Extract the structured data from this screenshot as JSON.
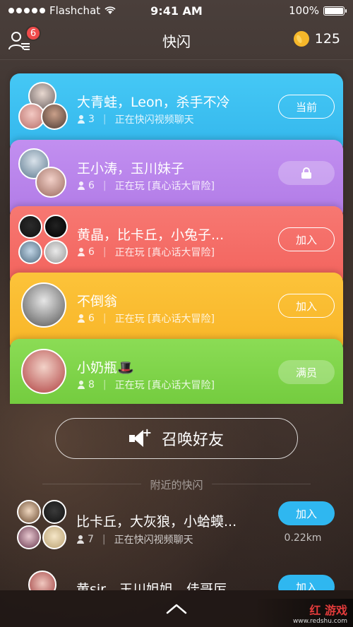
{
  "status": {
    "carrier": "Flashchat",
    "time": "9:41 AM",
    "battery": "100%",
    "battery_level": 1.0
  },
  "header": {
    "title": "快闪",
    "badge_count": "6",
    "coins": "125"
  },
  "rooms": [
    {
      "title": "大青蛙，Leon，杀手不冷",
      "count": "3",
      "activity": "正在快闪视频聊天",
      "button": "当前",
      "color": "#3fc0f2"
    },
    {
      "title": "王小涛，玉川妹子",
      "count": "6",
      "activity": "正在玩 [真心话大冒险]",
      "button": "",
      "button_icon": "lock-icon",
      "color": "#b985ec"
    },
    {
      "title": "黄晶，比卡丘，小兔子...",
      "count": "6",
      "activity": "正在玩 [真心话大冒险]",
      "button": "加入",
      "color": "#f46d67"
    },
    {
      "title": "不倒翁",
      "count": "6",
      "activity": "正在玩 [真心话大冒险]",
      "button": "加入",
      "color": "#fabd32"
    },
    {
      "title": "小奶瓶🎩",
      "count": "8",
      "activity": "正在玩 [真心话大冒险]",
      "button": "满员",
      "color": "#80d44a"
    }
  ],
  "summon": {
    "label": "召唤好友"
  },
  "nearby": {
    "label": "附近的快闪",
    "items": [
      {
        "title": "比卡丘，大灰狼，小蛤蟆...",
        "count": "7",
        "activity": "正在快闪视频聊天",
        "button": "加入",
        "distance": "0.22km"
      },
      {
        "title": "黄sir，玉川姐姐，佳哥厉",
        "button": "加入"
      }
    ]
  },
  "watermark": {
    "main": "红 游戏",
    "sub": "www.redshu.com"
  }
}
